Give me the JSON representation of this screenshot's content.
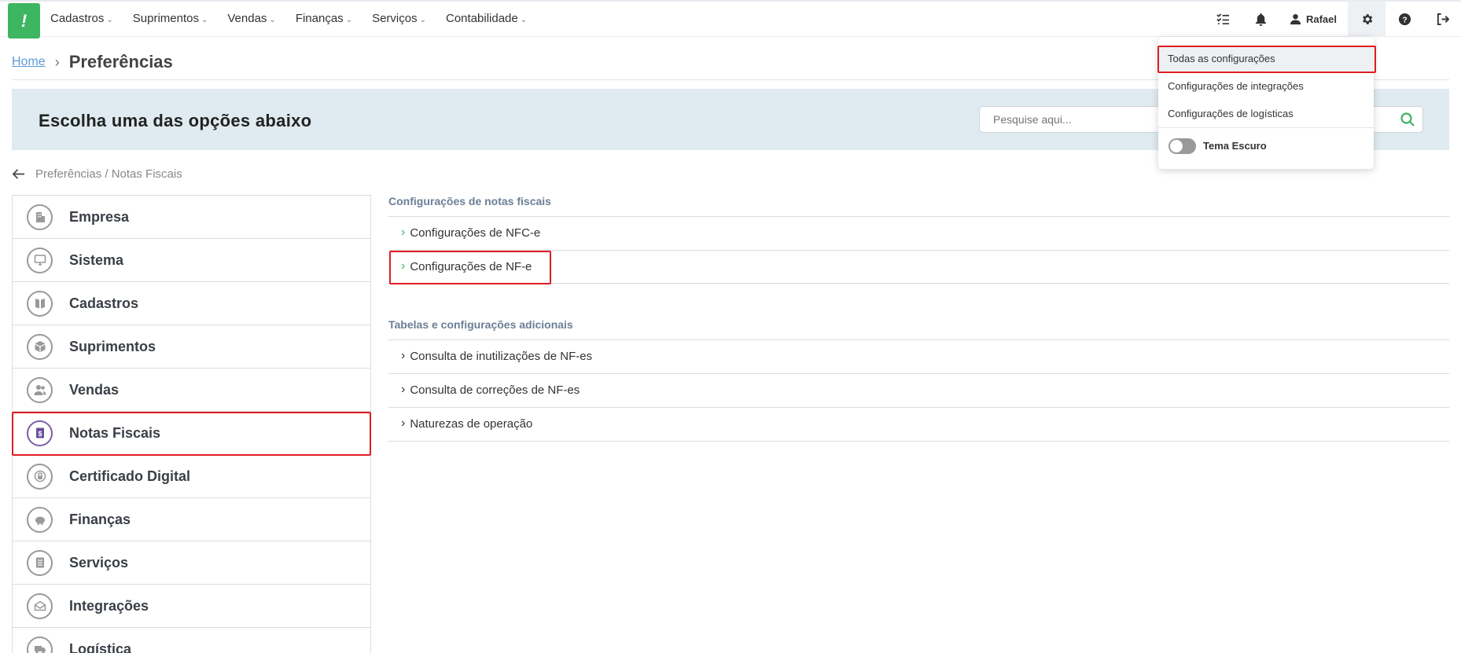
{
  "nav": {
    "logo_text": "!",
    "menu": [
      {
        "label": "Cadastros"
      },
      {
        "label": "Suprimentos"
      },
      {
        "label": "Vendas"
      },
      {
        "label": "Finanças"
      },
      {
        "label": "Serviços"
      },
      {
        "label": "Contabilidade"
      }
    ],
    "user_name": "Rafael",
    "icons": [
      "tasks-icon",
      "bell-icon",
      "user-icon",
      "gear-icon",
      "help-icon",
      "logout-icon"
    ]
  },
  "breadcrumb": {
    "home": "Home",
    "separator": "›",
    "current": "Preferências"
  },
  "banner": {
    "title": "Escolha uma das opções abaixo",
    "search_placeholder": "Pesquise aqui..."
  },
  "back_path": "Preferências / Notas Fiscais",
  "left_menu": [
    {
      "label": "Empresa",
      "icon": "building-icon"
    },
    {
      "label": "Sistema",
      "icon": "monitor-icon"
    },
    {
      "label": "Cadastros",
      "icon": "book-icon"
    },
    {
      "label": "Suprimentos",
      "icon": "box-icon"
    },
    {
      "label": "Vendas",
      "icon": "people-icon"
    },
    {
      "label": "Notas Fiscais",
      "icon": "invoice-icon",
      "active": true
    },
    {
      "label": "Certificado Digital",
      "icon": "lock-icon"
    },
    {
      "label": "Finanças",
      "icon": "piggy-bank-icon"
    },
    {
      "label": "Serviços",
      "icon": "document-icon"
    },
    {
      "label": "Integrações",
      "icon": "envelope-icon"
    },
    {
      "label": "Logística",
      "icon": "truck-icon"
    }
  ],
  "content": {
    "section1_title": "Configurações de notas fiscais",
    "section1_items": [
      "Configurações de NFC-e",
      "Configurações de NF-e"
    ],
    "section2_title": "Tabelas e configurações adicionais",
    "section2_items": [
      "Consulta de inutilizações de NF-es",
      "Consulta de correções de NF-es",
      "Naturezas de operação"
    ]
  },
  "settings_dropdown": {
    "items": [
      "Todas as configurações",
      "Configurações de integrações",
      "Configurações de logísticas"
    ],
    "toggle_label": "Tema Escuro",
    "toggle_on": false
  },
  "colors": {
    "brand": "#3db561",
    "highlight": "#e01c22",
    "banner_bg": "#dfebf0",
    "active_icon": "#7b5ea7"
  }
}
